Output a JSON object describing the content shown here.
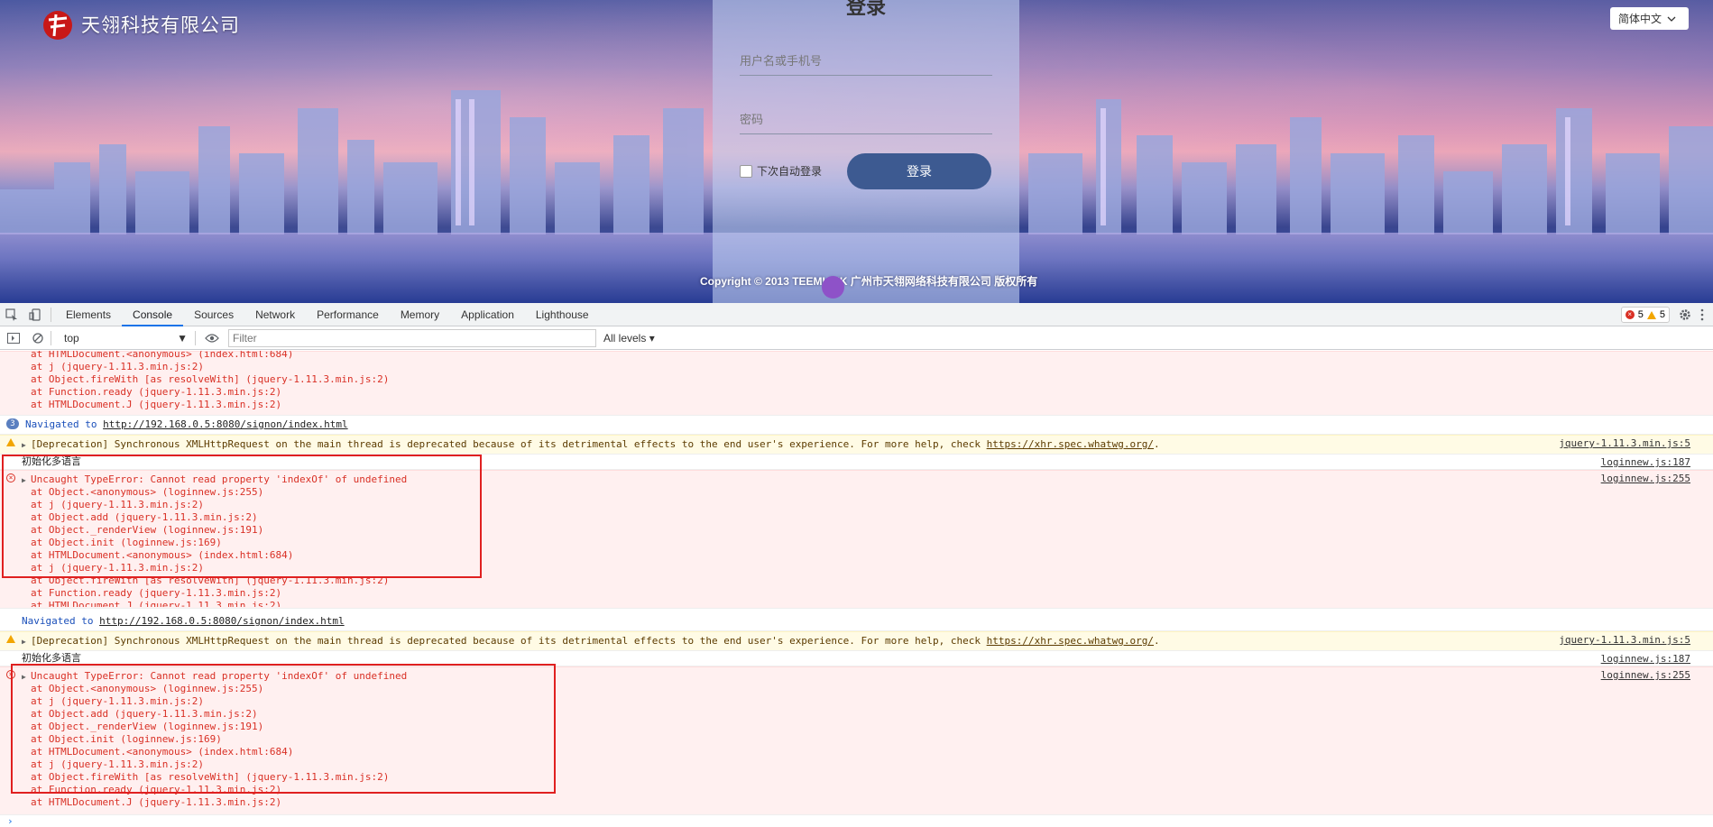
{
  "page": {
    "company_name": "天翎科技有限公司",
    "language": "简体中文",
    "login": {
      "title": "登录",
      "username_placeholder": "用户名或手机号",
      "password_placeholder": "密码",
      "remember_label": "下次自动登录",
      "submit_label": "登录"
    },
    "copyright": "Copyright © 2013 TEEMLINK 广州市天翎网络科技有限公司 版权所有"
  },
  "devtools": {
    "tabs": [
      {
        "label": "Elements"
      },
      {
        "label": "Console"
      },
      {
        "label": "Sources"
      },
      {
        "label": "Network"
      },
      {
        "label": "Performance"
      },
      {
        "label": "Memory"
      },
      {
        "label": "Application"
      },
      {
        "label": "Lighthouse"
      }
    ],
    "active_tab": "Console",
    "error_count": "5",
    "warning_count": "5",
    "context": "top",
    "filter_placeholder": "Filter",
    "levels": "All levels"
  },
  "console": {
    "top_stack": [
      "at HTMLDocument.<anonymous> (index.html:684)",
      "at j (jquery-1.11.3.min.js:2)",
      "at Object.fireWith [as resolveWith] (jquery-1.11.3.min.js:2)",
      "at Function.ready (jquery-1.11.3.min.js:2)",
      "at HTMLDocument.J (jquery-1.11.3.min.js:2)"
    ],
    "nav1": {
      "count": "3",
      "text": "Navigated to ",
      "url": "http://192.168.0.5:8080/signon/index.html"
    },
    "deprecation": {
      "text": "[Deprecation] Synchronous XMLHttpRequest on the main thread is deprecated because of its detrimental effects to the end user's experience. For more help, check ",
      "url": "https://xhr.spec.whatwg.org/",
      "tail": ".",
      "source": "jquery-1.11.3.min.js:5"
    },
    "init_text": "初始化多语言",
    "init_source": "loginnew.js:187",
    "error_head": "Uncaught TypeError: Cannot read property 'indexOf' of undefined",
    "error_source": "loginnew.js:255",
    "error_stack": [
      "at Object.<anonymous> (loginnew.js:255)",
      "at j (jquery-1.11.3.min.js:2)",
      "at Object.add (jquery-1.11.3.min.js:2)",
      "at Object._renderView (loginnew.js:191)",
      "at Object.init (loginnew.js:169)",
      "at HTMLDocument.<anonymous> (index.html:684)",
      "at j (jquery-1.11.3.min.js:2)",
      "at Object.fireWith [as resolveWith] (jquery-1.11.3.min.js:2)",
      "at Function.ready (jquery-1.11.3.min.js:2)",
      "at HTMLDocument.J (jquery-1.11.3.min.js:2)"
    ],
    "nav2": {
      "text": "Navigated to ",
      "url": "http://192.168.0.5:8080/signon/index.html"
    }
  },
  "colors": {
    "accent": "#1a73e8",
    "error": "#d93025",
    "warning": "#f2a600",
    "highlight_box": "#e02020",
    "login_button": "#3d5a91"
  }
}
